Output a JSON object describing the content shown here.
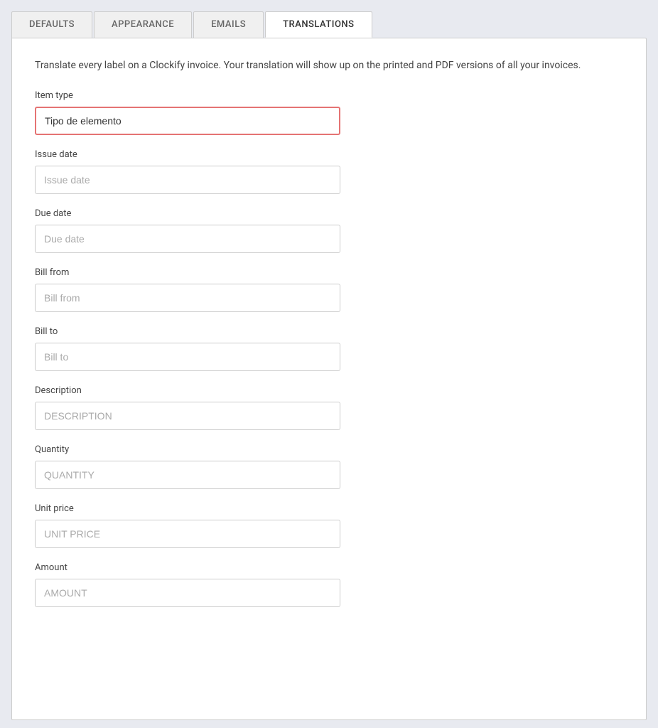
{
  "tabs": [
    {
      "id": "defaults",
      "label": "DEFAULTS",
      "active": false
    },
    {
      "id": "appearance",
      "label": "APPEARANCE",
      "active": false
    },
    {
      "id": "emails",
      "label": "EMAILS",
      "active": false
    },
    {
      "id": "translations",
      "label": "TRANSLATIONS",
      "active": true
    }
  ],
  "description": "Translate every label on a Clockify invoice. Your translation will show up on the printed and PDF versions of all your invoices.",
  "fields": [
    {
      "id": "item-type",
      "label": "Item type",
      "value": "Tipo de elemento",
      "placeholder": "",
      "active": true
    },
    {
      "id": "issue-date",
      "label": "Issue date",
      "value": "",
      "placeholder": "Issue date",
      "active": false
    },
    {
      "id": "due-date",
      "label": "Due date",
      "value": "",
      "placeholder": "Due date",
      "active": false
    },
    {
      "id": "bill-from",
      "label": "Bill from",
      "value": "",
      "placeholder": "Bill from",
      "active": false
    },
    {
      "id": "bill-to",
      "label": "Bill to",
      "value": "",
      "placeholder": "Bill to",
      "active": false
    },
    {
      "id": "description",
      "label": "Description",
      "value": "",
      "placeholder": "DESCRIPTION",
      "active": false
    },
    {
      "id": "quantity",
      "label": "Quantity",
      "value": "",
      "placeholder": "QUANTITY",
      "active": false
    },
    {
      "id": "unit-price",
      "label": "Unit price",
      "value": "",
      "placeholder": "UNIT PRICE",
      "active": false
    },
    {
      "id": "amount",
      "label": "Amount",
      "value": "",
      "placeholder": "AMOUNT",
      "active": false
    }
  ]
}
